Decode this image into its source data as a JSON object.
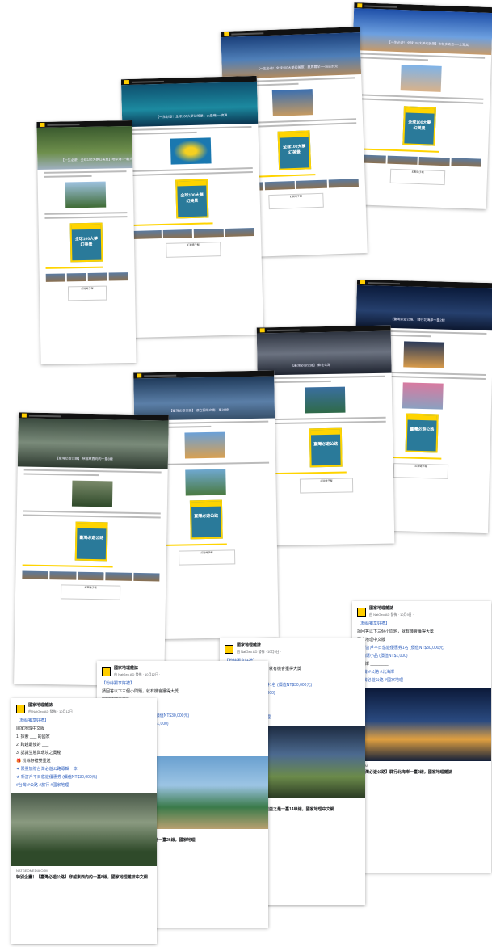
{
  "colors": {
    "brand_yellow": "#ffce00",
    "link_blue": "#2d5ebd"
  },
  "articles": [
    {
      "caption": "【一生必遊！全球100大夢幻美景】卡帕多奇亞──土耳其"
    },
    {
      "caption": "【一生必遊！全球100大夢幻美景】撒馬爾罕──烏茲別克"
    },
    {
      "caption": "【一生必遊！全球100大夢幻美景】大堡礁──澳洲"
    },
    {
      "caption": "【一生必遊！全球100大夢幻美景】地中海──義大利"
    },
    {
      "caption": "【臺灣必遊公路】 驛行北海岸一臺2線"
    },
    {
      "caption": "【臺灣必遊公路】 蘇花公路"
    },
    {
      "caption": "【臺灣必遊公路】 遠在國境之南一臺26線"
    },
    {
      "caption": "【臺灣必遊公路】 穿越東西向的一臺8線"
    }
  ],
  "magazine_label": "全球100大夢幻美景",
  "magazine_label_2": "臺灣必遊公路",
  "box_label": "訂閱電子報",
  "fb_posts": [
    {
      "page": "國家地理雜誌",
      "sub": "由 NatGeo AD 發佈 · 10月12日 · ",
      "lines": [
        "【粉絲獨享好禮】",
        "國家地理中文版",
        "1. 探索 ___ 的國家",
        "2. 跨越最後的 ___",
        "3. 認識生態與環境之奧秘",
        "🎁 粉絲好禮雙重送",
        "✦ 限量加贈台灣必遊公路專輯一本",
        "★ 新訂戶平日悠遊優惠券 (價值NT$30,000元)"
      ],
      "tags": "#台灣 #公路 #旅行 #國家地理",
      "source": "NATGEOMEDIA.COM",
      "title": "特別企畫！【臺灣必遊公路】穿越東西向的一臺8線，國家地理雜誌中文網"
    },
    {
      "page": "國家地理雜誌",
      "sub": "由 NatGeo AD 發佈 · 10月12日 · ",
      "lines": [
        "【粉絲獨享好禮】",
        "請回答以下三個小問題，就有機會獲得大獎",
        "國家地理中文版",
        "🎁 好禮雙重送",
        "★ 新訂戶平日悠遊優惠券1名 (價值NT$30,000元)",
        "★ 訂閱加贈精選小品 (價值NT$1,000)",
        "遠在國境之南 ________",
        "#台灣 #公路 #旅行"
      ],
      "tags": "#台灣必遊公路 #國家地理",
      "source": "NATGEOMEDIA.COM",
      "title": "【臺灣必遊公路】遠在國境之南一臺26線，國家地理"
    },
    {
      "page": "國家地理雜誌",
      "sub": "由 NatGeo AD 發佈 · 10月9日 · ",
      "lines": [
        "【粉絲獨享好禮】",
        "請回答以下三個小問題，就有機會獲得大獎",
        "國家地理中文版",
        "★ 新訂戶平日悠遊優惠券1名 (價值NT$30,000元)",
        "★ 精選小品 (價值NT$1,000)",
        "蘇花公路 ________",
        "#台灣 #公路 #花蓮"
      ],
      "tags": "#台灣必遊公路 #國家地理",
      "source": "NATGEOMEDIA.COM",
      "title": "【臺灣必遊公路】登上東亞之最一臺14甲線，國家地理中文網"
    },
    {
      "page": "國家地理雜誌",
      "sub": "由 NatGeo AD 發佈 · 10月9日 · ",
      "lines": [
        "【粉絲獨享好禮】",
        "請回答以下三個小問題，就有機會獲得大獎",
        "國家地理中文版",
        "★ 新訂戶平日悠遊優惠券1名 (價值NT$30,000元)",
        "★ 精選小品 (價值NT$1,000)",
        "北海岸 ________",
        "#台灣 #公路 #北海岸"
      ],
      "tags": "#台灣必遊公路 #國家地理",
      "source": "A.COM",
      "title": "【臺灣必遊公路】驛行北海岸一臺2線，國家地理雜誌"
    }
  ]
}
